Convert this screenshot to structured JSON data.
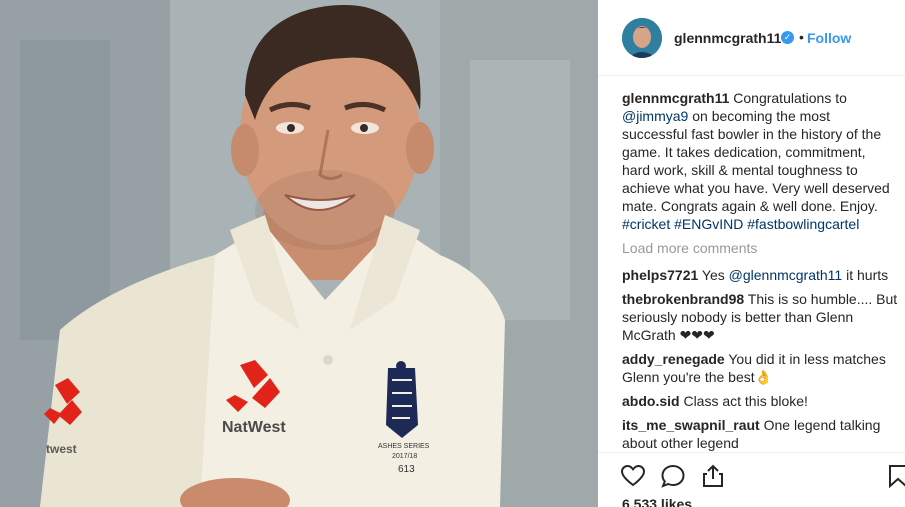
{
  "post": {
    "username": "glenn­mcgrath11",
    "follow_label": "Follow",
    "separator": "•",
    "verified_mark": "✓",
    "caption": {
      "username": "glennmcgrath11",
      "text_1": "Congratulations to",
      "mention": "@jimmya9",
      "text_2": "on becoming the most successful fast bowler in the history of the game. It takes dedication, commitment, hard work, skill & mental toughness to achieve what you have. Very well deserved mate. Congrats again & well done. Enjoy.",
      "hashtags": [
        "#cricket",
        "#ENGvIND",
        "#fastbowlingcartel"
      ]
    },
    "load_more": "Load more comments",
    "comments": [
      {
        "username": "phelps7721",
        "text_1": "Yes",
        "mention": "@glennmcgrath11",
        "text_2": "it hurts"
      },
      {
        "username": "thebrokenbrand98",
        "text": "This is so humble.... But seriously nobody is better than Glenn McGrath ❤❤❤"
      },
      {
        "username": "addy_renegade",
        "text": "You did it in less matches Glenn you're the best👌"
      },
      {
        "username": "abdo.sid",
        "text": "Class act this bloke!"
      },
      {
        "username": "its_me_swapnil_raut",
        "text": "One legend talking about other legend"
      }
    ],
    "likes": "6,533 likes"
  },
  "photo": {
    "shirt_sponsor": "NatWest",
    "crest_text_1": "ASHES SERIES",
    "crest_text_2": "2017/18",
    "crest_text_3": "613",
    "sleeve_text": "twest"
  },
  "icons": {
    "heart": "heart-icon",
    "comment": "comment-icon",
    "share": "share-icon",
    "bookmark": "bookmark-icon"
  },
  "colors": {
    "link": "#003569",
    "follow": "#3897f0",
    "muted": "#999999",
    "natwest_red": "#e2231a"
  }
}
